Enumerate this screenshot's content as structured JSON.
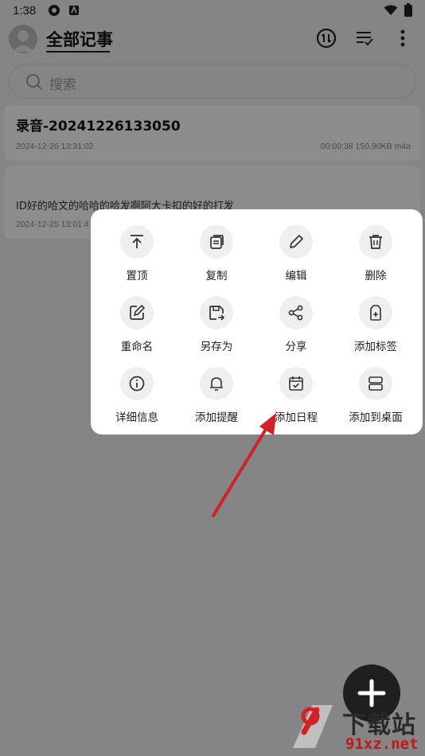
{
  "status_bar": {
    "time": "1:38"
  },
  "header": {
    "title": "全部记事"
  },
  "search": {
    "placeholder": "搜索"
  },
  "records": [
    {
      "title": "录音-20241226133050",
      "date": "2024-12-26 13:31:02",
      "meta": "00:00:38 150.90KB m4a"
    },
    {
      "text": "ID好的哈文的哈哈的哈发啊阿大卡扣的好的打发",
      "date": "2024-12-25 13:01:4"
    }
  ],
  "context_menu": {
    "items": [
      {
        "label": "置顶",
        "icon": "pin-top-icon"
      },
      {
        "label": "复制",
        "icon": "copy-icon"
      },
      {
        "label": "编辑",
        "icon": "edit-icon"
      },
      {
        "label": "删除",
        "icon": "delete-icon"
      },
      {
        "label": "重命名",
        "icon": "rename-icon"
      },
      {
        "label": "另存为",
        "icon": "save-as-icon"
      },
      {
        "label": "分享",
        "icon": "share-icon"
      },
      {
        "label": "添加标签",
        "icon": "add-tag-icon"
      },
      {
        "label": "详细信息",
        "icon": "info-icon"
      },
      {
        "label": "添加提醒",
        "icon": "bell-icon"
      },
      {
        "label": "添加日程",
        "icon": "calendar-icon"
      },
      {
        "label": "添加到桌面",
        "icon": "desktop-icon"
      }
    ]
  },
  "watermark": {
    "text": "下载站",
    "domain": "91xz.net"
  },
  "colors": {
    "accent": "#d42027",
    "fab": "#1f1f1f",
    "overlay": "#000000"
  }
}
